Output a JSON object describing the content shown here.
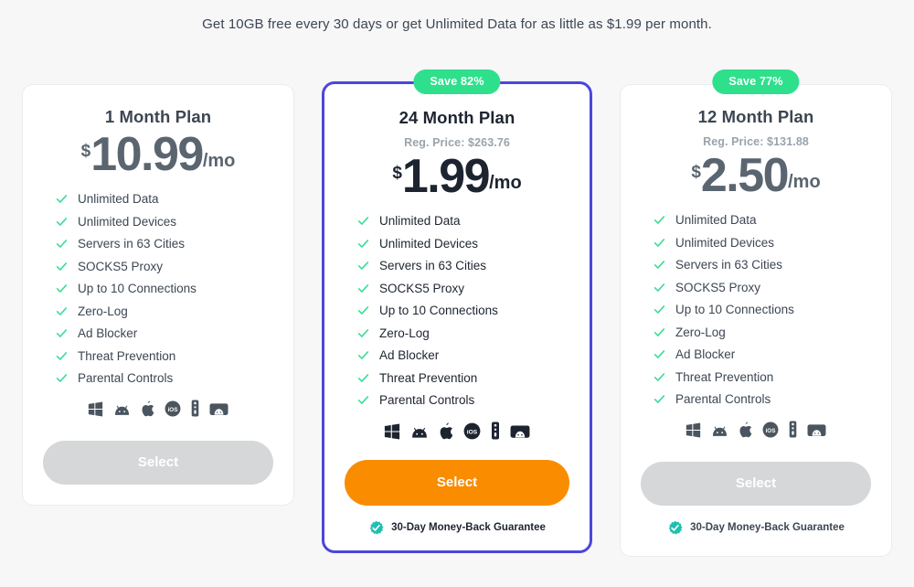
{
  "headline": "Get 10GB free every 30 days or get Unlimited Data for as little as $1.99 per month.",
  "colors": {
    "page_background": "#f7f7f8",
    "badge_green": "#2ee08c",
    "featured_border": "#4b46dc",
    "cta_orange": "#fa8c00",
    "cta_disabled_gray": "#d5d7d9",
    "check_green": "#3ddc97",
    "guarantee_teal": "#20bfb0"
  },
  "platform_icons": [
    "windows-icon",
    "android-icon",
    "apple-icon",
    "ios-icon",
    "tv-remote-icon",
    "android-tv-icon"
  ],
  "plans": [
    {
      "badge": null,
      "title": "1 Month Plan",
      "reg_price": null,
      "currency": "$",
      "price": "10.99",
      "period": "/mo",
      "features": [
        "Unlimited Data",
        "Unlimited Devices",
        "Servers in 63 Cities",
        "SOCKS5 Proxy",
        "Up to 10 Connections",
        "Zero-Log",
        "Ad Blocker",
        "Threat Prevention",
        "Parental Controls"
      ],
      "cta_label": "Select",
      "guarantee": null
    },
    {
      "badge": "Save 82%",
      "title": "24 Month Plan",
      "reg_price": "Reg. Price: $263.76",
      "currency": "$",
      "price": "1.99",
      "period": "/mo",
      "features": [
        "Unlimited Data",
        "Unlimited Devices",
        "Servers in 63 Cities",
        "SOCKS5 Proxy",
        "Up to 10 Connections",
        "Zero-Log",
        "Ad Blocker",
        "Threat Prevention",
        "Parental Controls"
      ],
      "cta_label": "Select",
      "guarantee": "30-Day Money-Back Guarantee"
    },
    {
      "badge": "Save 77%",
      "title": "12 Month Plan",
      "reg_price": "Reg. Price: $131.88",
      "currency": "$",
      "price": "2.50",
      "period": "/mo",
      "features": [
        "Unlimited Data",
        "Unlimited Devices",
        "Servers in 63 Cities",
        "SOCKS5 Proxy",
        "Up to 10 Connections",
        "Zero-Log",
        "Ad Blocker",
        "Threat Prevention",
        "Parental Controls"
      ],
      "cta_label": "Select",
      "guarantee": "30-Day Money-Back Guarantee"
    }
  ]
}
